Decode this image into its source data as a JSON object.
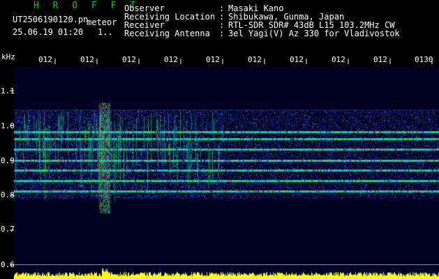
{
  "app": {
    "brand": "H R O F F T",
    "file_name": "UT2506190120.pn",
    "mode": "meteor",
    "date_time": "25.06.19 01:20",
    "indicator": "1.."
  },
  "info": {
    "labels": [
      "Observer",
      "Receiving Location",
      "Receiver",
      "Receiving Antenna"
    ],
    "separators": [
      ":",
      ":",
      ":",
      ":"
    ],
    "values": [
      "Masaki Kano",
      "Shibukawa, Gunma, Japan",
      "RTL-SDR SDR# 43dB L15 103.2MHz CW",
      "3el Yagi(V) Az 330 for Vladivostok"
    ]
  },
  "axis": {
    "unit": "kHz",
    "time_ticks": [
      "012",
      "012",
      "012",
      "012",
      "012",
      "012",
      "012",
      "012",
      "012",
      "0130"
    ],
    "freq_ticks": [
      "1.1",
      "1.0",
      "0.9",
      "0.8",
      "0.7",
      "0.6"
    ],
    "freq_values": [
      1.1,
      1.0,
      0.9,
      0.8,
      0.7,
      0.6
    ]
  },
  "spectrogram": {
    "freq_range": [
      0.6,
      1.15
    ],
    "band_edges": [
      0.79,
      1.045
    ],
    "strong_lines": [
      0.812,
      0.842,
      0.872,
      0.9,
      0.932,
      0.962,
      0.982
    ],
    "palette": {
      "background": "#000020",
      "noise": "#1a2a8a",
      "low": "#00c8c8",
      "mid": "#20e040",
      "high": "#ff2020",
      "amplitude": "#ffff00",
      "tick": "#ffffff"
    }
  }
}
